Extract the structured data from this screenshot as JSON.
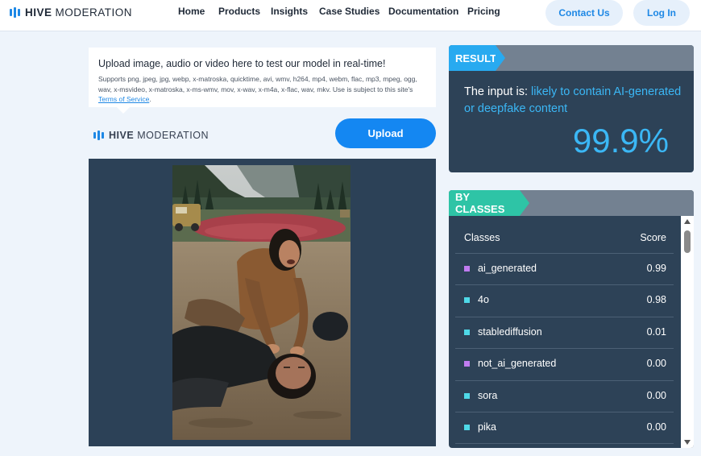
{
  "nav": {
    "brand_bold": "HIVE",
    "brand_light": "MODERATION",
    "links": [
      "Home",
      "Products",
      "Insights",
      "Case Studies",
      "Documentation",
      "Pricing"
    ],
    "contact_label": "Contact Us",
    "login_label": "Log In"
  },
  "upload": {
    "title": "Upload image, audio or video here to test our model in real-time!",
    "supports": "Supports png, jpeg, jpg, webp, x-matroska, quicktime, avi, wmv, h264, mp4, webm, flac, mp3, mpeg, ogg, wav, x-msvideo, x-matroska, x-ms-wmv, mov, x-wav, x-m4a, x-flac, wav, mkv. Use is subject to this site's",
    "terms_link": "Terms of Service",
    "terms_suffix": ".",
    "button_label": "Upload",
    "brand_bold": "HIVE",
    "brand_light": "MODERATION"
  },
  "result": {
    "tag": "RESULT",
    "prefix": "The input is: ",
    "verdict": "likely to contain AI-generated or deepfake content",
    "score": "99.9%"
  },
  "classes": {
    "tag": "BY CLASSES",
    "col_class": "Classes",
    "col_score": "Score",
    "rows": [
      {
        "name": "ai_generated",
        "score": "0.99",
        "color": "#c07cf0"
      },
      {
        "name": "4o",
        "score": "0.98",
        "color": "#4fd9e8"
      },
      {
        "name": "stablediffusion",
        "score": "0.01",
        "color": "#4fd9e8"
      },
      {
        "name": "not_ai_generated",
        "score": "0.00",
        "color": "#c07cf0"
      },
      {
        "name": "sora",
        "score": "0.00",
        "color": "#4fd9e8"
      },
      {
        "name": "pika",
        "score": "0.00",
        "color": "#4fd9e8"
      }
    ]
  },
  "colors": {
    "accent_blue": "#1487f2",
    "panel": "#2d4257",
    "highlight": "#3bb7f5",
    "tag_result": "#28aaf0",
    "tag_classes": "#2ec4a6"
  }
}
